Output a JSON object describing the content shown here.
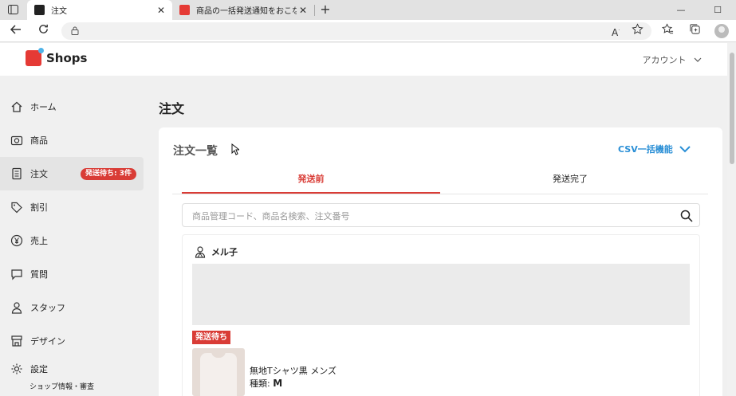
{
  "browser": {
    "tabs": [
      {
        "title": "注文",
        "active": true
      },
      {
        "title": "商品の一括発送通知をおこなう際の",
        "active": false
      }
    ],
    "new_tab": "+",
    "window_controls": [
      "—",
      "☐"
    ]
  },
  "header": {
    "logo_text": "Shops",
    "account_label": "アカウント"
  },
  "sidebar": {
    "items": [
      {
        "label": "ホーム",
        "icon": "home-icon"
      },
      {
        "label": "商品",
        "icon": "camera-icon"
      },
      {
        "label": "注文",
        "icon": "clipboard-icon",
        "badge": "発送待ち: 3件",
        "active": true
      },
      {
        "label": "割引",
        "icon": "tag-icon"
      },
      {
        "label": "売上",
        "icon": "yen-icon"
      },
      {
        "label": "質問",
        "icon": "chat-icon"
      },
      {
        "label": "スタッフ",
        "icon": "person-icon"
      },
      {
        "label": "デザイン",
        "icon": "storefront-icon"
      },
      {
        "label": "設定",
        "icon": "gear-icon",
        "sub": "ショップ情報・審査"
      }
    ]
  },
  "main": {
    "page_title": "注文",
    "card_title": "注文一覧",
    "csv_label": "CSV一括機能",
    "tabs": [
      {
        "label": "発送前",
        "active": true
      },
      {
        "label": "発送完了",
        "active": false
      }
    ],
    "search_placeholder": "商品管理コード、商品名検索、注文番号",
    "order": {
      "customer": "メル子",
      "status": "発送待ち",
      "product_name": "無地Tシャツ黒 メンズ",
      "variant_label": "種類:",
      "variant_value": "M"
    }
  },
  "colors": {
    "accent_red": "#d93c36",
    "link_blue": "#2a8fd6"
  }
}
